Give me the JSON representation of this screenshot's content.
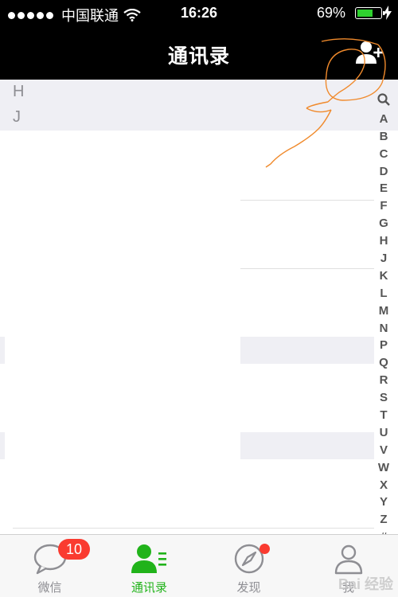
{
  "status_bar": {
    "carrier": "中国联通",
    "time": "16:26",
    "battery_percent": "69%",
    "battery_level": 0.69,
    "signal_bars": 5
  },
  "nav": {
    "title": "通讯录",
    "add_icon": "add-contact-icon"
  },
  "sections": [
    "H",
    "J"
  ],
  "index_bar": [
    "Q",
    "A",
    "B",
    "C",
    "D",
    "E",
    "F",
    "G",
    "H",
    "J",
    "K",
    "L",
    "M",
    "N",
    "P",
    "Q",
    "R",
    "S",
    "T",
    "U",
    "V",
    "W",
    "X",
    "Y",
    "Z",
    "#"
  ],
  "tabs": [
    {
      "label": "微信",
      "icon": "chat-bubble-icon",
      "badge": "10"
    },
    {
      "label": "通讯录",
      "icon": "contacts-icon",
      "active": true
    },
    {
      "label": "发现",
      "icon": "compass-icon",
      "dot": true
    },
    {
      "label": "我",
      "icon": "person-icon"
    }
  ],
  "colors": {
    "accent": "#21b31a",
    "badge": "#fa3b30",
    "navbar": "#000000",
    "section_bg": "#efeff4"
  },
  "watermark": "Bai 经验"
}
